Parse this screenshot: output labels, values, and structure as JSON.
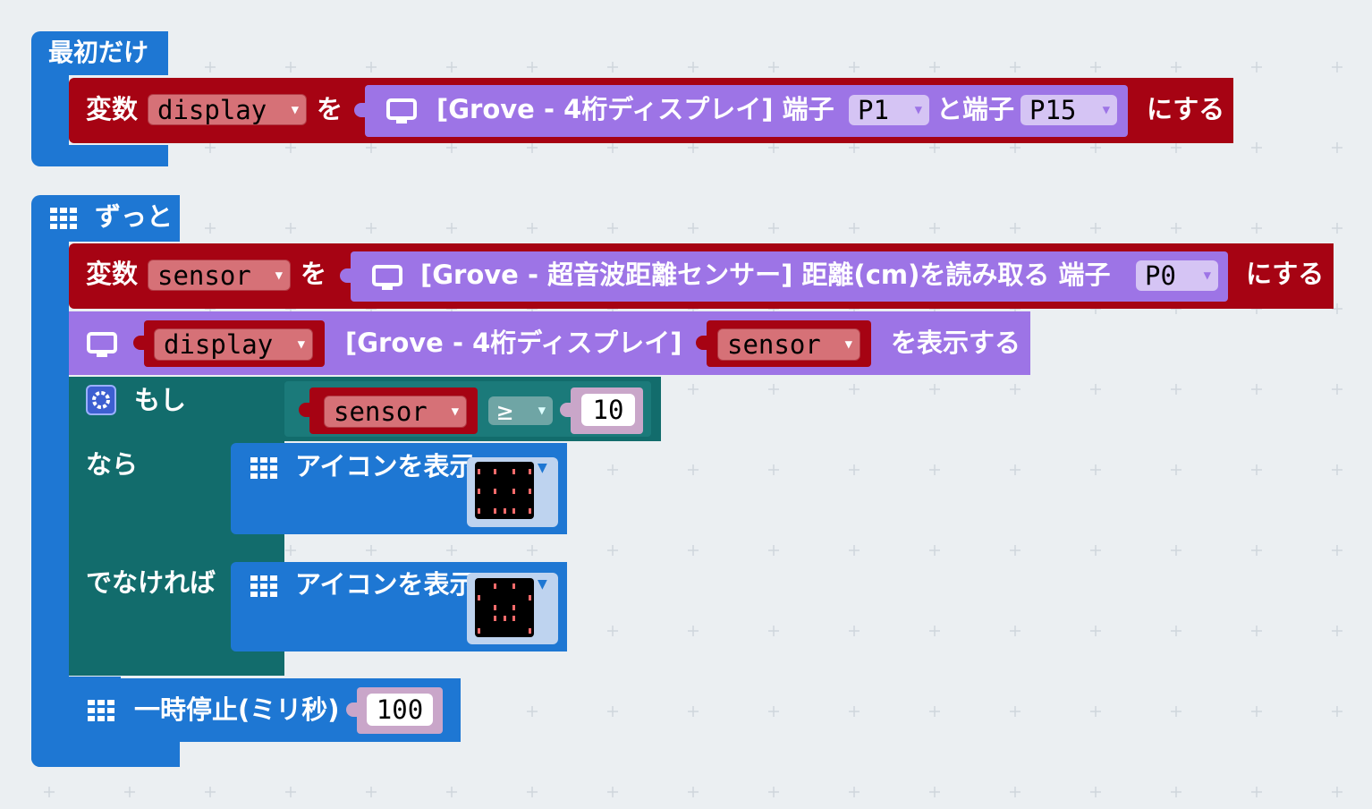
{
  "on_start": {
    "hat_label": "最初だけ",
    "set_label": "変数",
    "var_name": "display",
    "to_label": "を",
    "create_label": "[Grove - 4桁ディスプレイ] 端子",
    "pin1": "P1",
    "and_pin_label": "と端子",
    "pin2": "P15",
    "set_suffix": "にする"
  },
  "forever": {
    "hat_label": "ずっと",
    "set_sensor": {
      "set_label": "変数",
      "var_name": "sensor",
      "to_label": "を",
      "read_label": "[Grove - 超音波距離センサー] 距離(cm)を読み取る 端子",
      "pin": "P0",
      "set_suffix": "にする"
    },
    "show_number": {
      "display_var": "display",
      "label": "[Grove - 4桁ディスプレイ]",
      "value_var": "sensor",
      "suffix": "を表示する"
    },
    "if_block": {
      "if_label": "もし",
      "cond_var": "sensor",
      "operator": "≥",
      "cond_value": "10",
      "then_label": "なら",
      "else_label": "でなければ",
      "then_action": "アイコンを表示",
      "else_action": "アイコンを表示"
    },
    "pause": {
      "label": "一時停止(ミリ秒)",
      "value": "100"
    }
  },
  "colors": {
    "basic": "#1e77d3",
    "variables": "#a60313",
    "grove": "#9d74e6",
    "logic": "#126c6c",
    "workspace": "#ebeff2"
  }
}
